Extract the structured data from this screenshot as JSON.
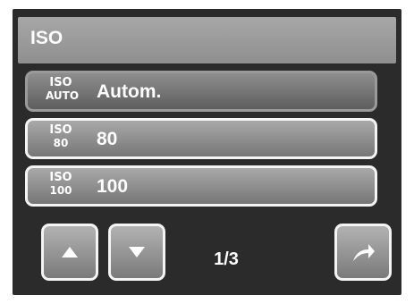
{
  "header": {
    "title": "ISO"
  },
  "items": [
    {
      "badge_top": "ISO",
      "badge_bottom": "AUTO",
      "label": "Autom.",
      "selected": true
    },
    {
      "badge_top": "ISO",
      "badge_bottom": "80",
      "label": "80",
      "selected": false
    },
    {
      "badge_top": "ISO",
      "badge_bottom": "100",
      "label": "100",
      "selected": false
    }
  ],
  "pagination": {
    "text": "1/3"
  },
  "icons": {
    "up": "arrow-up-icon",
    "down": "arrow-down-icon",
    "back": "return-arrow-icon"
  }
}
